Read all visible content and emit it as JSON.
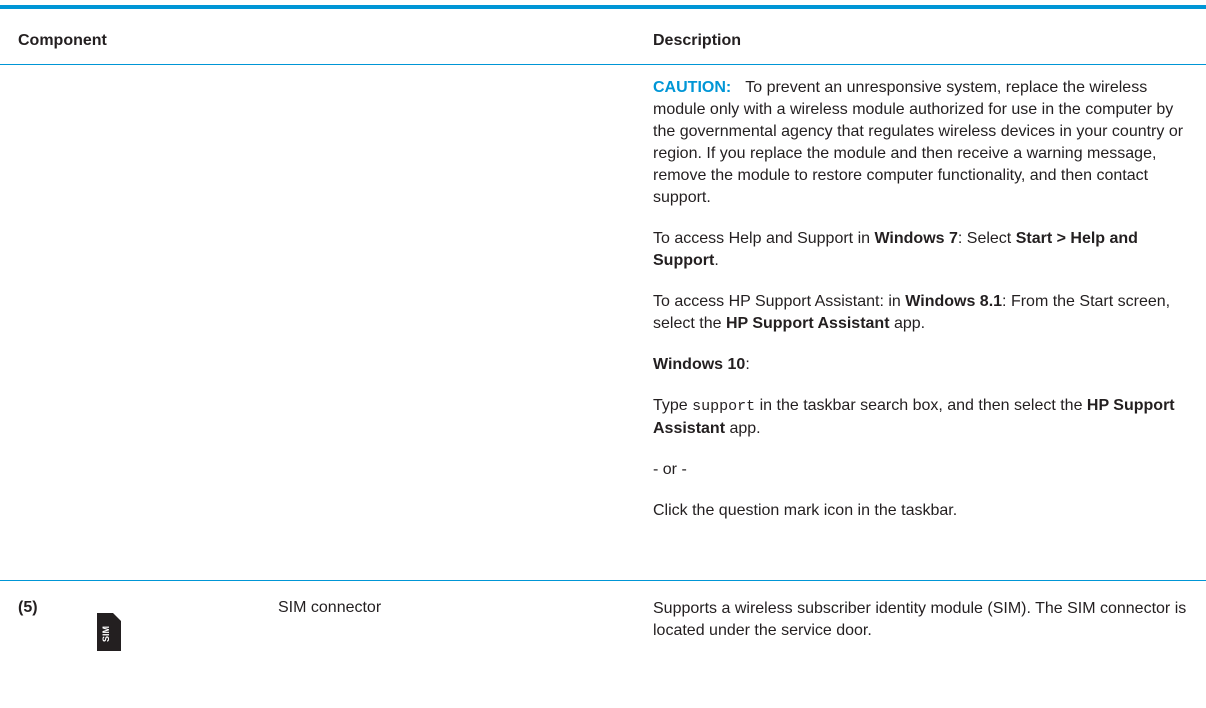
{
  "table": {
    "header": {
      "component": "Component",
      "description": "Description"
    },
    "row_continuation": {
      "caution_label": "CAUTION:",
      "caution_text": "To prevent an unresponsive system, replace the wireless module only with a wireless module authorized for use in the computer by the governmental agency that regulates wireless devices in your country or region. If you replace the module and then receive a warning message, remove the module to restore computer functionality, and then contact support.",
      "win7": {
        "prefix": "To access Help and Support in ",
        "os": "Windows 7",
        "mid": ": Select ",
        "path": "Start > Help and Support",
        "suffix": "."
      },
      "win81": {
        "prefix": "To access HP Support Assistant: in ",
        "os": "Windows 8.1",
        "mid": ": From the Start screen, select the ",
        "app": "HP Support Assistant",
        "suffix": " app."
      },
      "win10_heading": {
        "os": "Windows 10",
        "suffix": ":"
      },
      "win10_type": {
        "prefix": "Type ",
        "command": "support",
        "mid": " in the taskbar search box, and then select the ",
        "app": "HP Support Assistant",
        "suffix": " app."
      },
      "or_separator": "- or -",
      "question_mark_text": "Click the question mark icon in the taskbar."
    },
    "row5": {
      "number": "(5)",
      "icon": "sim-card-icon",
      "icon_text": "SIM",
      "name": "SIM connector",
      "description": "Supports a wireless subscriber identity module (SIM). The SIM connector is located under the service door."
    }
  },
  "colors": {
    "accent": "#0096d6",
    "text": "#231f20"
  }
}
